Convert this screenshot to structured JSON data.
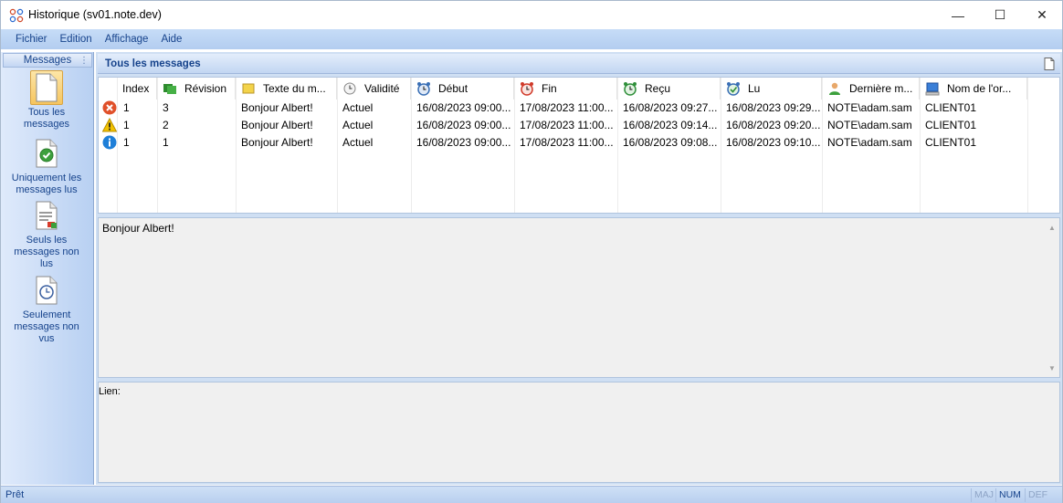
{
  "window": {
    "title": "Historique (sv01.note.dev)",
    "minimize": "—",
    "maximize": "☐",
    "close": "✕"
  },
  "menu": {
    "items": [
      "Fichier",
      "Edition",
      "Affichage",
      "Aide"
    ]
  },
  "left": {
    "header": "Messages",
    "items": [
      {
        "label_lines": [
          "Tous les",
          "messages"
        ],
        "icon": "blank-document-icon"
      },
      {
        "label_lines": [
          "Uniquement les",
          "messages lus"
        ],
        "icon": "document-check-icon"
      },
      {
        "label_lines": [
          "Seuls les",
          "messages non",
          "lus"
        ],
        "icon": "document-unread-icon"
      },
      {
        "label_lines": [
          "Seulement",
          "messages non",
          "vus"
        ],
        "icon": "document-clock-icon"
      }
    ]
  },
  "main": {
    "header": "Tous les messages",
    "columns": [
      "Index",
      "Révision",
      "Texte du m...",
      "Validité",
      "Début",
      "Fin",
      "Reçu",
      "Lu",
      "Dernière m...",
      "Nom de l'or..."
    ],
    "rows": [
      {
        "status": "error",
        "index": "1",
        "revision": "3",
        "text": "Bonjour Albert!",
        "validity": "Actuel",
        "start": "16/08/2023 09:00...",
        "end": "17/08/2023 11:00...",
        "received": "16/08/2023 09:27...",
        "read": "16/08/2023 09:29...",
        "last": "NOTE\\adam.sam",
        "computer": "CLIENT01"
      },
      {
        "status": "warning",
        "index": "1",
        "revision": "2",
        "text": "Bonjour Albert!",
        "validity": "Actuel",
        "start": "16/08/2023 09:00...",
        "end": "17/08/2023 11:00...",
        "received": "16/08/2023 09:14...",
        "read": "16/08/2023 09:20...",
        "last": "NOTE\\adam.sam",
        "computer": "CLIENT01"
      },
      {
        "status": "info",
        "index": "1",
        "revision": "1",
        "text": "Bonjour Albert!",
        "validity": "Actuel",
        "start": "16/08/2023 09:00...",
        "end": "17/08/2023 11:00...",
        "received": "16/08/2023 09:08...",
        "read": "16/08/2023 09:10...",
        "last": "NOTE\\adam.sam",
        "computer": "CLIENT01"
      }
    ],
    "message_text": "Bonjour Albert!",
    "link_label": "Lien:"
  },
  "status": {
    "text": "Prêt",
    "maj": "MAJ",
    "num": "NUM",
    "def": "DEF"
  },
  "colors": {
    "accent": "#15428b",
    "menu_bg": "#c6dcf7",
    "error": "#e0502a",
    "warning": "#f2c200",
    "info": "#1e7fd8"
  }
}
